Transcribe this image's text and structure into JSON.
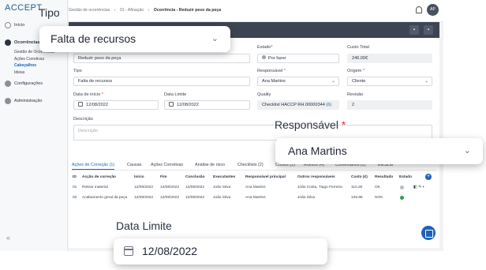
{
  "app": {
    "logo": "ACCEPT"
  },
  "sidebar": {
    "items": [
      {
        "label": "Início",
        "icon": "info-icon"
      },
      {
        "label": "Ocorrências",
        "icon": "alert-icon"
      },
      {
        "label": "Configurações",
        "icon": "gear-icon"
      },
      {
        "label": "Administração",
        "icon": "admin-icon"
      }
    ],
    "sub_items": [
      {
        "label": "Gestão de Ocorrências"
      },
      {
        "label": "Ações Corretivas"
      },
      {
        "label": "Cabeçalhos"
      },
      {
        "label": "Ideias"
      }
    ],
    "selected_sub_item": "Cabeçalhos",
    "collapse_glyph": "«"
  },
  "topbar": {
    "breadcrumb": [
      "Gestão de ocorrências",
      "01 - Afinação",
      "Ocorrência - Reduzir peso da peça"
    ],
    "separator": "›",
    "avatar_initials": "AP"
  },
  "form": {
    "title_value": "Reduzir peso da peça",
    "estado_label": "Estado",
    "estado_value": "Por fazer",
    "custo_total_label": "Custo Total",
    "custo_total_value": "246.00€",
    "tipo_label": "Tipo",
    "tipo_value": "Falta de recursos",
    "responsavel_label": "Responsável",
    "responsavel_value": "Ana Martins",
    "origem_label": "Origem",
    "origem_value": "Cliente",
    "data_inicio_label": "Data de início",
    "data_inicio_value": "12/08/2022",
    "data_limite_label": "Data Limite",
    "data_limite_value": "12/08/2022",
    "quality_label": "Quality",
    "quality_value": "Checklist HACCP RH.00000344",
    "quality_count": "(6)",
    "revisao_label": "Revisão",
    "revisao_value": "2",
    "descricao_label": "Descrição",
    "descricao_placeholder": "Descrição",
    "required_mark": "*"
  },
  "tabs": [
    "Ações de Correção (1)",
    "Causas",
    "Ações Corretivas",
    "Análise de risco",
    "Checklists (2)",
    "Custos (2)",
    "Anexos (4)",
    "Comentários (2)",
    "Eficácia"
  ],
  "table": {
    "headers": [
      "ID",
      "Acção de correção",
      "Início",
      "Fim",
      "Conclusão",
      "Executantes",
      "Responsável principal",
      "Outros responsáveis",
      "Custo (€)",
      "Resultado",
      "Estado"
    ],
    "rows": [
      [
        "01",
        "Retirar material",
        "12/08/2022",
        "12/08/2022",
        "12/08/2022",
        "João Silva",
        "Ana Martins",
        "João Costa, Tiago Ferreira",
        "110.2€",
        "OK"
      ],
      [
        "02",
        "Acabamento geral da peça",
        "12/08/2022",
        "12/08/2022",
        "12/08/2022",
        "João Silva",
        "Ana Martins",
        "João Silva",
        "125.8€",
        "NOK"
      ]
    ],
    "row_status_colors": [
      "#b8bcc2",
      "#2e9e4f"
    ]
  },
  "callouts": {
    "tipo_caption": "Tipo",
    "tipo_value": "Falta de recursos",
    "responsavel_caption": "Responsável",
    "responsavel_value": "Ana Martins",
    "data_limite_caption": "Data Limite",
    "data_limite_value": "12/08/2022"
  },
  "colors": {
    "accent": "#1c63b8",
    "header_bar": "#3d4554",
    "required": "#d9363e",
    "ok_status": "#2e9e4f"
  }
}
